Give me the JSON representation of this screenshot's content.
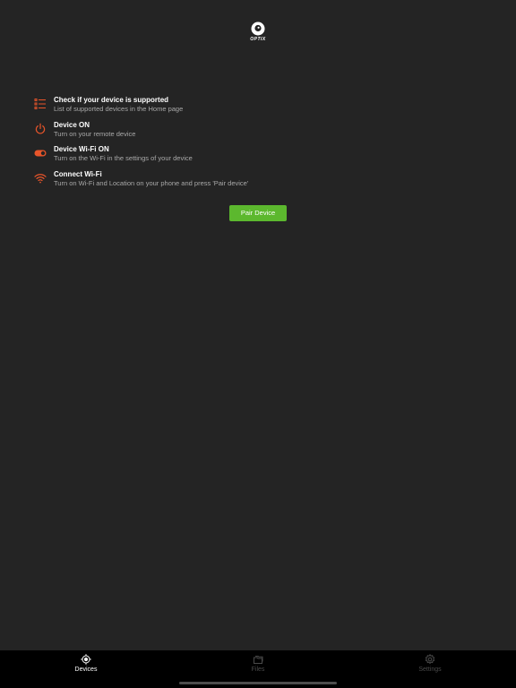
{
  "app": {
    "logo_text": "OPTIX"
  },
  "colors": {
    "background": "#242424",
    "accent": "#e8552a",
    "button": "#5cb82e",
    "tabbar": "#000000"
  },
  "steps": [
    {
      "icon": "checklist-icon",
      "title": "Check if your device is supported",
      "desc": "List of supported devices in the Home page"
    },
    {
      "icon": "power-icon",
      "title": "Device ON",
      "desc": "Turn on your remote device"
    },
    {
      "icon": "toggle-icon",
      "title": "Device Wi-Fi ON",
      "desc": "Turn on the Wi-Fi in the settings of your device"
    },
    {
      "icon": "wifi-icon",
      "title": "Connect Wi-Fi",
      "desc": "Turn on Wi-Fi and Location on your phone and press 'Pair device'"
    }
  ],
  "pair_button": {
    "label": "Pair Device"
  },
  "tabbar": {
    "tabs": [
      {
        "label": "Devices",
        "icon": "crosshair-icon",
        "active": true
      },
      {
        "label": "Files",
        "icon": "folder-icon",
        "active": false
      },
      {
        "label": "Settings",
        "icon": "gear-icon",
        "active": false
      }
    ]
  }
}
